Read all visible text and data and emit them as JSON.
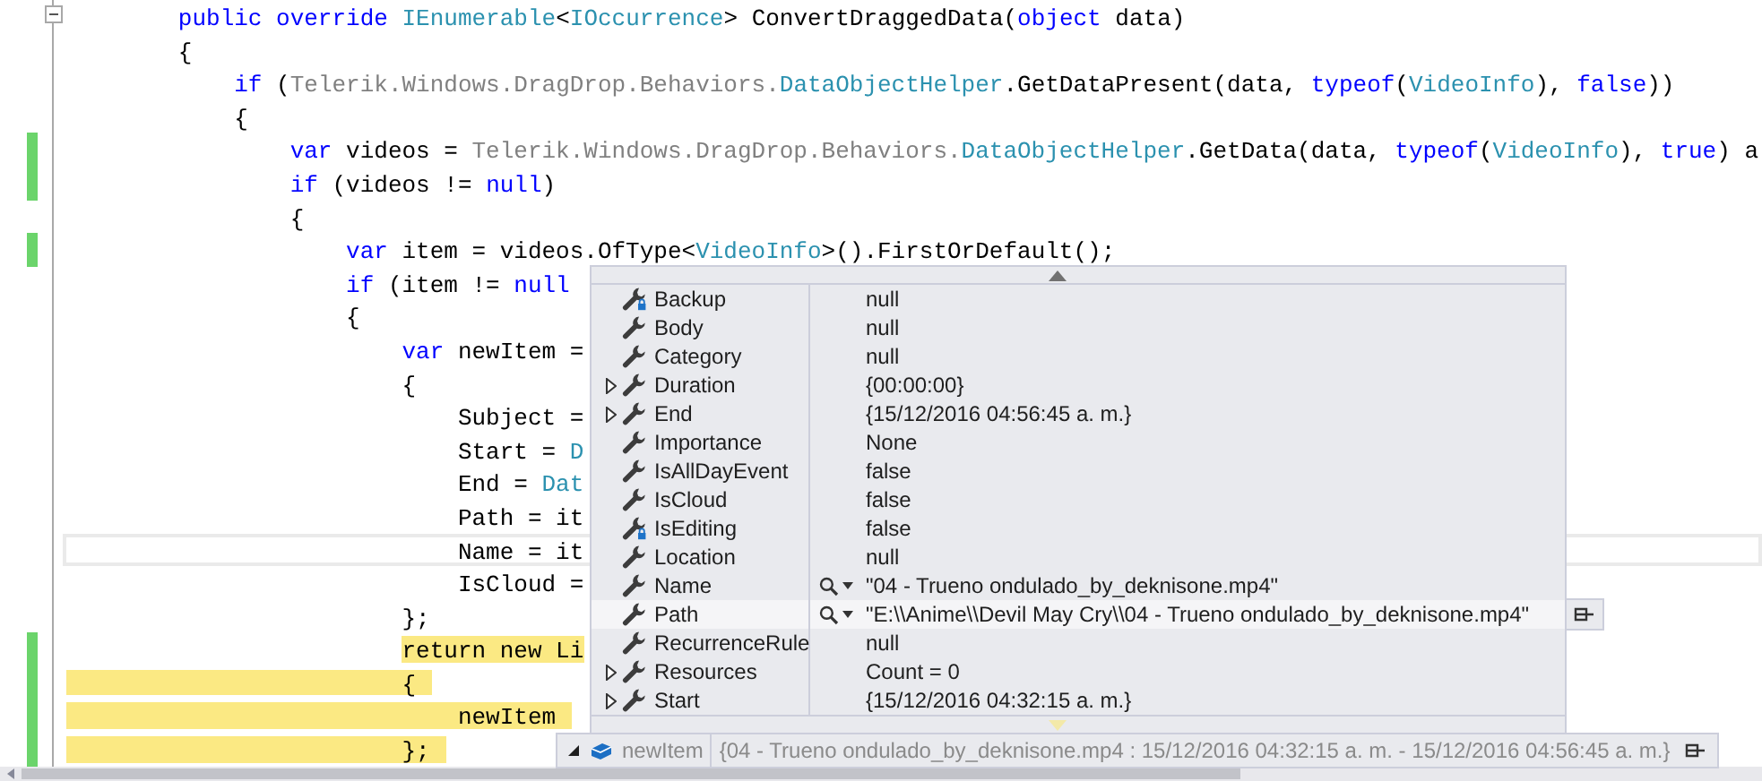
{
  "code_lines": [
    {
      "fold": true,
      "changed": false,
      "highlighted": false,
      "current": false,
      "tokens": [
        {
          "t": "        public override ",
          "kind": "kw"
        },
        {
          "t": "IEnumerable",
          "kind": "type"
        },
        {
          "t": "<",
          "kind": "plain"
        },
        {
          "t": "IOccurrence",
          "kind": "type"
        },
        {
          "t": "> ConvertDraggedData(",
          "kind": "plain"
        },
        {
          "t": "object",
          "kind": "kw"
        },
        {
          "t": " data)",
          "kind": "plain"
        }
      ]
    },
    {
      "fold": false,
      "changed": false,
      "highlighted": false,
      "current": false,
      "tokens": [
        {
          "t": "        {",
          "kind": "plain"
        }
      ]
    },
    {
      "fold": false,
      "changed": false,
      "highlighted": false,
      "current": false,
      "tokens": [
        {
          "t": "            if",
          "kind": "kw"
        },
        {
          "t": " (",
          "kind": "plain"
        },
        {
          "t": "Telerik.Windows.DragDrop.Behaviors.",
          "kind": "ns"
        },
        {
          "t": "DataObjectHelper",
          "kind": "type"
        },
        {
          "t": ".GetDataPresent(data, ",
          "kind": "plain"
        },
        {
          "t": "typeof",
          "kind": "kw"
        },
        {
          "t": "(",
          "kind": "plain"
        },
        {
          "t": "VideoInfo",
          "kind": "type"
        },
        {
          "t": "), ",
          "kind": "plain"
        },
        {
          "t": "false",
          "kind": "kw"
        },
        {
          "t": "))",
          "kind": "plain"
        }
      ]
    },
    {
      "fold": false,
      "changed": false,
      "highlighted": false,
      "current": false,
      "tokens": [
        {
          "t": "            {",
          "kind": "plain"
        }
      ]
    },
    {
      "fold": false,
      "changed": true,
      "highlighted": false,
      "current": false,
      "tokens": [
        {
          "t": "                var",
          "kind": "kw"
        },
        {
          "t": " videos = ",
          "kind": "plain"
        },
        {
          "t": "Telerik.Windows.DragDrop.Behaviors.",
          "kind": "ns"
        },
        {
          "t": "DataObjectHelper",
          "kind": "type"
        },
        {
          "t": ".GetData(data, ",
          "kind": "plain"
        },
        {
          "t": "typeof",
          "kind": "kw"
        },
        {
          "t": "(",
          "kind": "plain"
        },
        {
          "t": "VideoInfo",
          "kind": "type"
        },
        {
          "t": "), ",
          "kind": "plain"
        },
        {
          "t": "true",
          "kind": "kw"
        },
        {
          "t": ") a",
          "kind": "plain"
        }
      ]
    },
    {
      "fold": false,
      "changed": true,
      "highlighted": false,
      "current": false,
      "tokens": [
        {
          "t": "                if",
          "kind": "kw"
        },
        {
          "t": " (videos != ",
          "kind": "plain"
        },
        {
          "t": "null",
          "kind": "kw"
        },
        {
          "t": ")",
          "kind": "plain"
        }
      ]
    },
    {
      "fold": false,
      "changed": false,
      "highlighted": false,
      "current": false,
      "tokens": [
        {
          "t": "                {",
          "kind": "plain"
        }
      ]
    },
    {
      "fold": false,
      "changed": true,
      "highlighted": false,
      "current": false,
      "tokens": [
        {
          "t": "                    var",
          "kind": "kw"
        },
        {
          "t": " item = videos.OfType<",
          "kind": "plain"
        },
        {
          "t": "VideoInfo",
          "kind": "type"
        },
        {
          "t": ">().FirstOrDefault();",
          "kind": "plain"
        }
      ]
    },
    {
      "fold": false,
      "changed": false,
      "highlighted": false,
      "current": false,
      "tokens": [
        {
          "t": "                    if",
          "kind": "kw"
        },
        {
          "t": " (item != ",
          "kind": "plain"
        },
        {
          "t": "null",
          "kind": "kw"
        }
      ]
    },
    {
      "fold": false,
      "changed": false,
      "highlighted": false,
      "current": false,
      "tokens": [
        {
          "t": "                    {",
          "kind": "plain"
        }
      ]
    },
    {
      "fold": false,
      "changed": false,
      "highlighted": false,
      "current": false,
      "tokens": [
        {
          "t": "                        var",
          "kind": "kw"
        },
        {
          "t": " newItem =",
          "kind": "plain"
        }
      ]
    },
    {
      "fold": false,
      "changed": false,
      "highlighted": false,
      "current": false,
      "tokens": [
        {
          "t": "                        {",
          "kind": "plain"
        }
      ]
    },
    {
      "fold": false,
      "changed": false,
      "highlighted": false,
      "current": false,
      "tokens": [
        {
          "t": "                            Subject =",
          "kind": "plain"
        }
      ]
    },
    {
      "fold": false,
      "changed": false,
      "highlighted": false,
      "current": false,
      "tokens": [
        {
          "t": "                            Start = ",
          "kind": "plain"
        },
        {
          "t": "D",
          "kind": "type"
        }
      ]
    },
    {
      "fold": false,
      "changed": false,
      "highlighted": false,
      "current": false,
      "tokens": [
        {
          "t": "                            End = ",
          "kind": "plain"
        },
        {
          "t": "Dat",
          "kind": "type"
        }
      ]
    },
    {
      "fold": false,
      "changed": false,
      "highlighted": false,
      "current": false,
      "tokens": [
        {
          "t": "                            Path = it",
          "kind": "plain"
        }
      ]
    },
    {
      "fold": false,
      "changed": false,
      "highlighted": false,
      "current": true,
      "tokens": [
        {
          "t": "                            Name = it",
          "kind": "plain"
        }
      ]
    },
    {
      "fold": false,
      "changed": false,
      "highlighted": false,
      "current": false,
      "tokens": [
        {
          "t": "                            IsCloud =",
          "kind": "plain"
        }
      ]
    },
    {
      "fold": false,
      "changed": false,
      "highlighted": false,
      "current": false,
      "tokens": [
        {
          "t": "                        };",
          "kind": "plain"
        }
      ]
    },
    {
      "fold": false,
      "changed": true,
      "highlighted": true,
      "band": false,
      "current": false,
      "tokens": [
        {
          "t": "                        return new Li",
          "kind": "plain"
        }
      ]
    },
    {
      "fold": false,
      "changed": true,
      "highlighted": true,
      "band": true,
      "current": false,
      "tokens": [
        {
          "t": "                        {",
          "kind": "plain"
        }
      ]
    },
    {
      "fold": false,
      "changed": true,
      "highlighted": true,
      "band": true,
      "current": false,
      "tokens": [
        {
          "t": "                            newItem",
          "kind": "plain"
        }
      ]
    },
    {
      "fold": false,
      "changed": true,
      "highlighted": true,
      "band": true,
      "current": false,
      "tokens": [
        {
          "t": "                        };",
          "kind": "plain"
        }
      ]
    }
  ],
  "datatip_popup": {
    "rows": [
      {
        "name": "Backup",
        "value": "null",
        "expandable": false,
        "private": true,
        "search": false,
        "selected": false
      },
      {
        "name": "Body",
        "value": "null",
        "expandable": false,
        "private": false,
        "search": false,
        "selected": false
      },
      {
        "name": "Category",
        "value": "null",
        "expandable": false,
        "private": false,
        "search": false,
        "selected": false
      },
      {
        "name": "Duration",
        "value": "{00:00:00}",
        "expandable": true,
        "private": false,
        "search": false,
        "selected": false
      },
      {
        "name": "End",
        "value": "{15/12/2016 04:56:45 a. m.}",
        "expandable": true,
        "private": false,
        "search": false,
        "selected": false
      },
      {
        "name": "Importance",
        "value": "None",
        "expandable": false,
        "private": false,
        "search": false,
        "selected": false
      },
      {
        "name": "IsAllDayEvent",
        "value": "false",
        "expandable": false,
        "private": false,
        "search": false,
        "selected": false
      },
      {
        "name": "IsCloud",
        "value": "false",
        "expandable": false,
        "private": false,
        "search": false,
        "selected": false
      },
      {
        "name": "IsEditing",
        "value": "false",
        "expandable": false,
        "private": true,
        "search": false,
        "selected": false
      },
      {
        "name": "Location",
        "value": "null",
        "expandable": false,
        "private": false,
        "search": false,
        "selected": false
      },
      {
        "name": "Name",
        "value": "\"04 - Trueno ondulado_by_deknisone.mp4\"",
        "expandable": false,
        "private": false,
        "search": true,
        "selected": false
      },
      {
        "name": "Path",
        "value": "\"E:\\\\Anime\\\\Devil May Cry\\\\04 - Trueno ondulado_by_deknisone.mp4\"",
        "expandable": false,
        "private": false,
        "search": true,
        "selected": true
      },
      {
        "name": "RecurrenceRule",
        "value": "null",
        "expandable": false,
        "private": false,
        "search": false,
        "selected": false
      },
      {
        "name": "Resources",
        "value": "Count = 0",
        "expandable": true,
        "private": false,
        "search": false,
        "selected": false
      },
      {
        "name": "Start",
        "value": "{15/12/2016 04:32:15 a. m.}",
        "expandable": true,
        "private": false,
        "search": false,
        "selected": false
      }
    ]
  },
  "datatip": {
    "expanded": true,
    "name": "newItem",
    "value": "{04 - Trueno ondulado_by_deknisone.mp4 : 15/12/2016 04:32:15 a. m. - 15/12/2016 04:56:45 a. m.}"
  }
}
